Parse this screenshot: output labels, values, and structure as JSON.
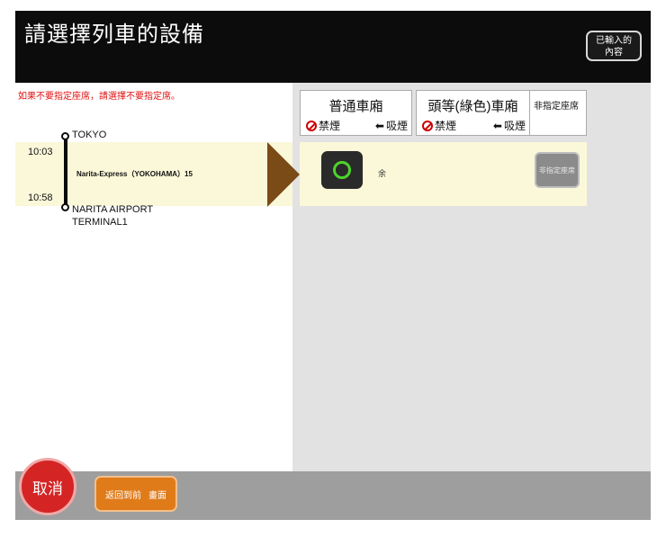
{
  "header": {
    "title": "請選擇列車的設備",
    "confirm_label_line1": "已輸入的",
    "confirm_label_line2": "內容"
  },
  "notice": "如果不要指定座席，請選擇不要指定席。",
  "car_types": {
    "ordinary": {
      "title": "普通車廂",
      "no_smoking": "禁煙",
      "smoking": "吸煙"
    },
    "green": {
      "title": "頭等(綠色)車廂",
      "no_smoking": "禁煙",
      "smoking": "吸煙"
    },
    "unreserved": {
      "title": "非指定座席"
    }
  },
  "train": {
    "departure_station": "TOKYO",
    "departure_time": "10:03",
    "name": "Narita-Express（YOKOHAMA）15",
    "arrival_time": "10:58",
    "arrival_station_line1": "NARITA AIRPORT",
    "arrival_station_line2": "TERMINAL1"
  },
  "seat_row": {
    "note": "余",
    "unreserved_button": "非指定座席"
  },
  "footer": {
    "cancel": "取消",
    "back": "返回到前",
    "back_suffix": "畫面"
  },
  "colors": {
    "availability_ring": "#4cd42a",
    "cancel": "#d42424",
    "back": "#e07b1a"
  }
}
